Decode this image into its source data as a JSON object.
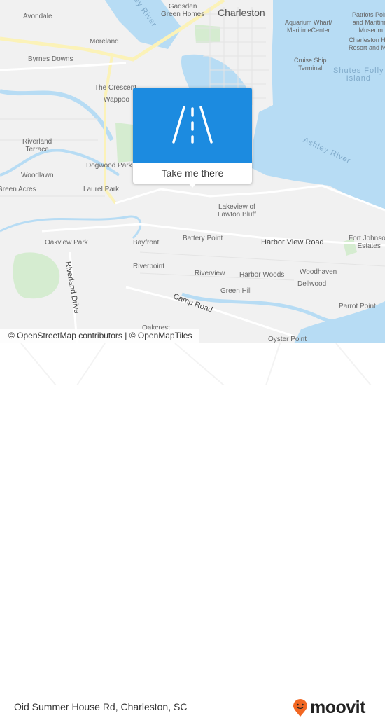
{
  "map": {
    "colors": {
      "water": "#b7dcf4",
      "land": "#f1f1f1",
      "park": "#d5ecd0",
      "road_major": "#fbf2b8"
    },
    "labels": {
      "avondale": "Avondale",
      "moreland": "Moreland",
      "byrnes_downs": "Byrnes Downs",
      "gadsden": "Gadsden\nGreen Homes",
      "charleston": "Charleston",
      "ashley_river_top": "Ashley River",
      "aquarium": "Aquarium Wharf/\nMaritimeCenter",
      "patriots": "Patriots Point\nand Maritime\nMuseum",
      "harbor_resort": "Charleston Harbor\nResort and Marina",
      "cruise": "Cruise Ship\nTerminal",
      "shutes": "Shutes Folly\nIsland",
      "crescent": "The Crescent",
      "wappoo": "Wappoo",
      "riverland_terrace": "Riverland\nTerrace",
      "woodlawn": "Woodlawn",
      "green_acres": "Green Acres",
      "dogwood": "Dogwood Park",
      "laurel": "Laurel Park",
      "ashley_river": "Ashley River",
      "lakeview": "Lakeview of\nLawton Bluff",
      "harbor_view": "Harbor View Road",
      "fort_johnson": "Fort Johnson\nEstates",
      "oakview": "Oakview Park",
      "bayfront": "Bayfront",
      "battery_point": "Battery Point",
      "riverpoint": "Riverpoint",
      "riverview": "Riverview",
      "harbor_woods": "Harbor Woods",
      "woodhaven": "Woodhaven",
      "dellwood": "Dellwood",
      "green_hill": "Green Hill",
      "riverland_drive": "Riverland Drive",
      "camp_road": "Camp Road",
      "parrot_point": "Parrot Point",
      "oakcrest": "Oakcrest",
      "oyster_point": "Oyster Point"
    }
  },
  "popup": {
    "icon": "road-icon",
    "button_label": "Take me there",
    "color": "#1c8be0"
  },
  "attribution": "© OpenStreetMap contributors | © OpenMapTiles",
  "footer": {
    "address": "Oid Summer House Rd, Charleston, SC",
    "logo_text": "moovit",
    "logo_color": "#f26722"
  }
}
